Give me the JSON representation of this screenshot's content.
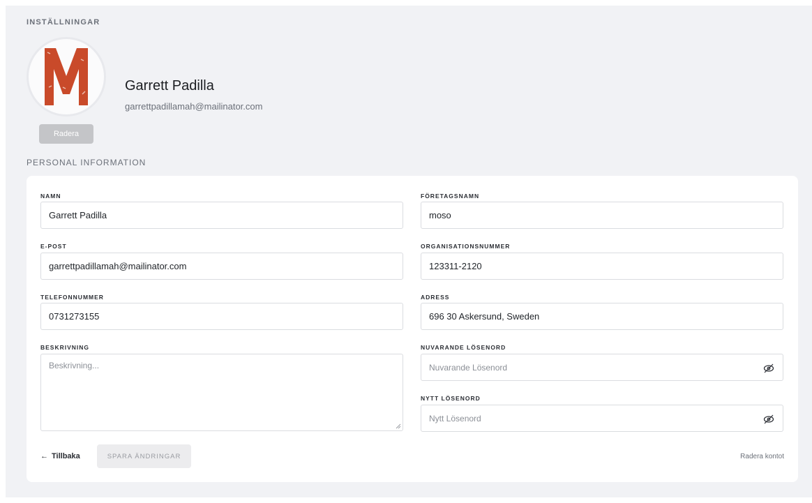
{
  "header": {
    "settings_title": "INSTÄLLNINGAR",
    "personal_title": "PERSONAL INFORMATION"
  },
  "profile": {
    "avatar_letter": "M",
    "name": "Garrett Padilla",
    "email": "garrettpadillamah@mailinator.com",
    "delete_avatar_label": "Radera"
  },
  "form": {
    "name": {
      "label": "NAMN",
      "value": "Garrett Padilla"
    },
    "company": {
      "label": "FÖRETAGSNAMN",
      "value": "moso"
    },
    "email": {
      "label": "E-POST",
      "value": "garrettpadillamah@mailinator.com"
    },
    "org_number": {
      "label": "ORGANISATIONSNUMMER",
      "value": "123311-2120"
    },
    "phone": {
      "label": "TELEFONNUMMER",
      "value": "0731273155"
    },
    "address": {
      "label": "ADRESS",
      "value": "696 30 Askersund, Sweden"
    },
    "description": {
      "label": "BESKRIVNING",
      "placeholder": "Beskrivning..."
    },
    "current_password": {
      "label": "NUVARANDE LÖSENORD",
      "placeholder": "Nuvarande Lösenord"
    },
    "new_password": {
      "label": "NYTT LÖSENORD",
      "placeholder": "Nytt Lösenord"
    }
  },
  "actions": {
    "back_label": "Tillbaka",
    "save_label": "SPARA ÄNDRINGAR",
    "delete_account_label": "Radera kontot"
  },
  "colors": {
    "page_bg": "#f1f2f5",
    "avatar_red": "#c94a2a",
    "disabled_button": "#c4c5c8"
  },
  "icons": {
    "avatar": "letter-m-logo",
    "back": "arrow-left-icon",
    "password_toggle": "eye-off-icon"
  }
}
